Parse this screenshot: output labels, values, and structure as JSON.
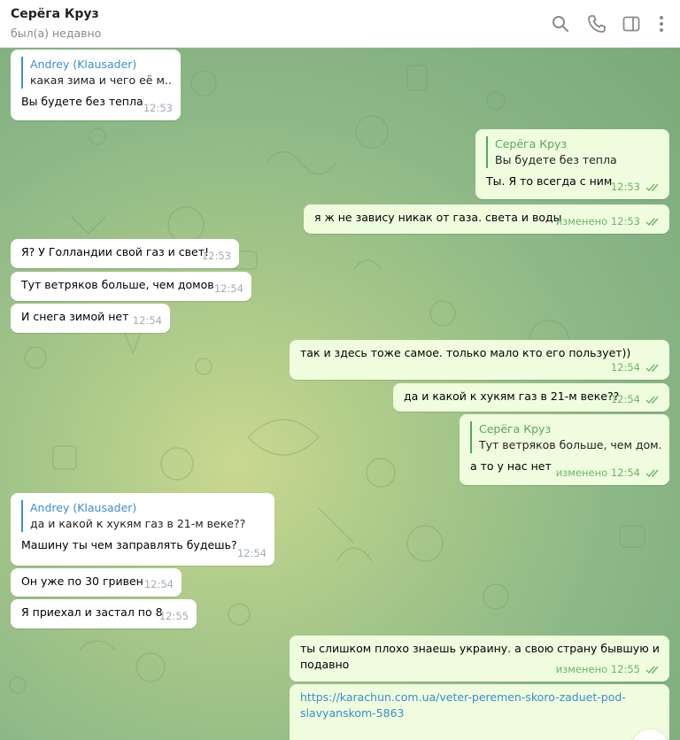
{
  "header": {
    "name": "Серёга Круз",
    "status": "был(а) недавно"
  },
  "icons": [
    "search-icon",
    "phone-icon",
    "sidebar-icon",
    "more-icon"
  ],
  "colors": {
    "incoming": "#ffffff",
    "outgoing": "#effdde",
    "accent": "#3c8fce",
    "time_out": "#6db46a"
  },
  "messages": [
    {
      "reply_name": "Andrey (Klausader)",
      "reply_text": "какая зима и чего её м...",
      "text": "Вы будете без тепла",
      "time": "12:53"
    },
    {
      "reply_name": "Серёга Круз",
      "reply_text": "Вы будете без тепла",
      "text": "Ты. Я то всегда с ним",
      "time": "12:53"
    },
    {
      "text": "я ж не завису никак от газа. света и воды",
      "time": "изменено 12:53"
    },
    {
      "text": "Я? У Голландии свой газ и свет!",
      "time": "12:53"
    },
    {
      "text": "Тут ветряков больше, чем домов",
      "time": "12:54"
    },
    {
      "text": "И снега зимой нет",
      "time": "12:54"
    },
    {
      "text": "так и здесь тоже самое. только мало кто его пользует))",
      "time": "12:54"
    },
    {
      "text": "да и какой к хукям газ в 21-м веке??",
      "time": "12:54"
    },
    {
      "reply_name": "Серёга Круз",
      "reply_text": "Тут ветряков больше, чем дом...",
      "text": "а то у нас нет",
      "time": "изменено 12:54"
    },
    {
      "reply_name": "Andrey (Klausader)",
      "reply_text": "да и какой к хукям газ в 21-м веке??",
      "text": "Машину ты чем заправлять будешь?",
      "time": "12:54"
    },
    {
      "text": "Он уже по 30 гривен",
      "time": "12:54"
    },
    {
      "text": "Я приехал и застал по 8",
      "time": "12:55"
    },
    {
      "text_line1": "ты слишком плохо знаешь украину. а свою страну бывшую и",
      "text_line2": "подавно",
      "time": "изменено 12:55"
    },
    {
      "link_line1": "https://karachun.com.ua/veter-peremen-skoro-zaduet-pod-",
      "link_line2": "slavyanskom-5863"
    }
  ]
}
